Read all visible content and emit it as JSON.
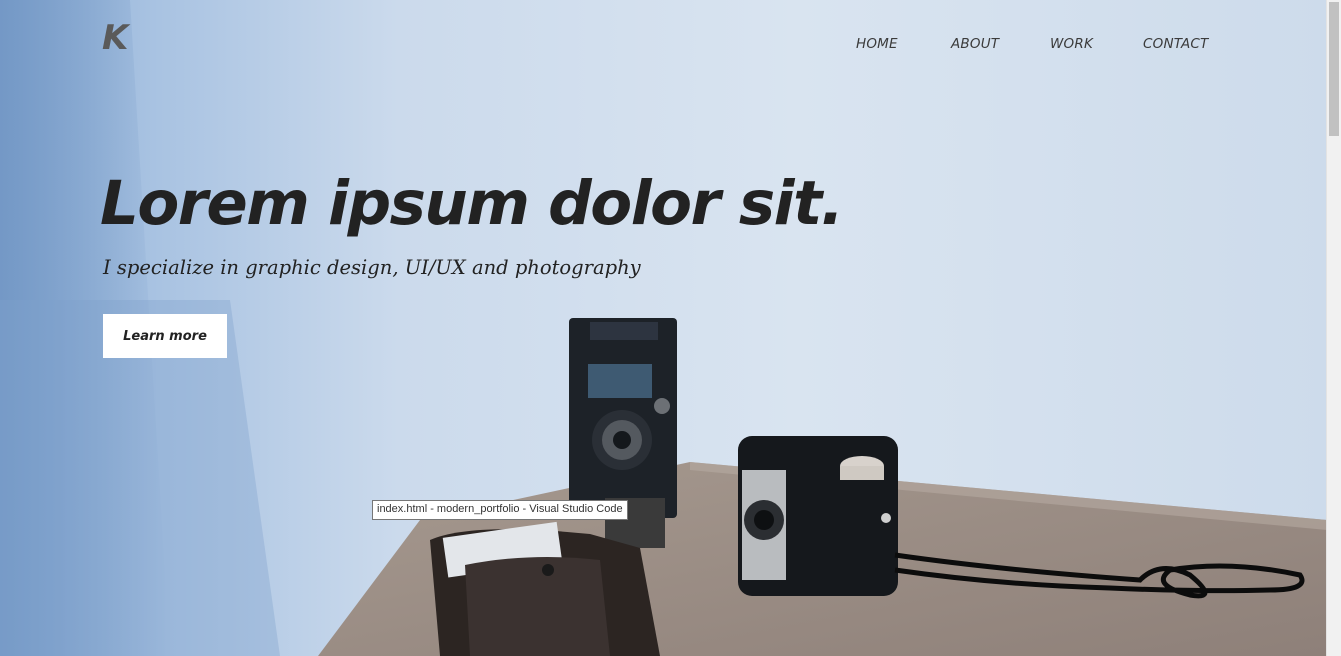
{
  "header": {
    "logo": "K",
    "nav": [
      {
        "label": "HOME"
      },
      {
        "label": "ABOUT"
      },
      {
        "label": "WORK"
      },
      {
        "label": "CONTACT"
      }
    ]
  },
  "hero": {
    "title": "Lorem ipsum dolor sit.",
    "subtitle": "I specialize in graphic design, UI/UX and photography",
    "cta_label": "Learn more"
  },
  "tooltip": {
    "text": "index.html - modern_portfolio - Visual Studio Code"
  },
  "colors": {
    "wall": "#cfdcec",
    "text": "#222222",
    "logo": "#5a5a5a",
    "button_bg": "#ffffff",
    "table": "#a89c94"
  }
}
